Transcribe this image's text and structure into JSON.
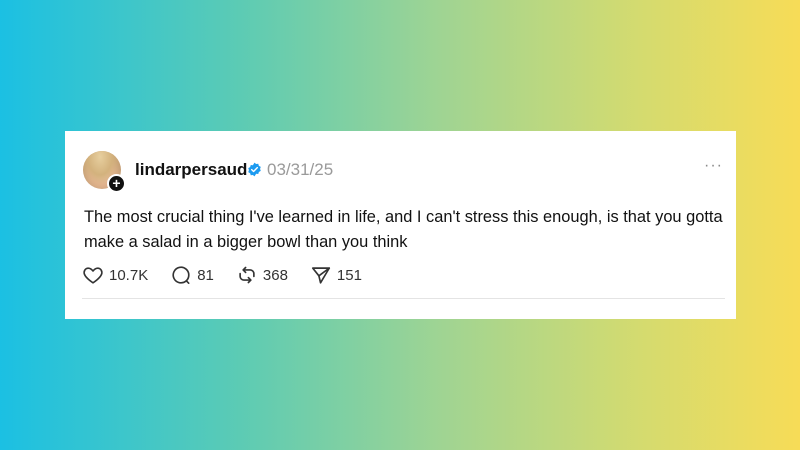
{
  "post": {
    "username": "lindarpersaud",
    "date": "03/31/25",
    "text": "The most crucial thing I've learned in life, and I can't stress this enough, is that you gotta make a salad in a bigger bowl than you think",
    "more_label": "···",
    "follow_label": "+",
    "avatar_icon": "avatar-photo",
    "verified_icon": "verified-badge-icon",
    "verified_color": "#1d9bf0"
  },
  "actions": {
    "likes": "10.7K",
    "replies": "81",
    "reposts": "368",
    "shares": "151"
  }
}
